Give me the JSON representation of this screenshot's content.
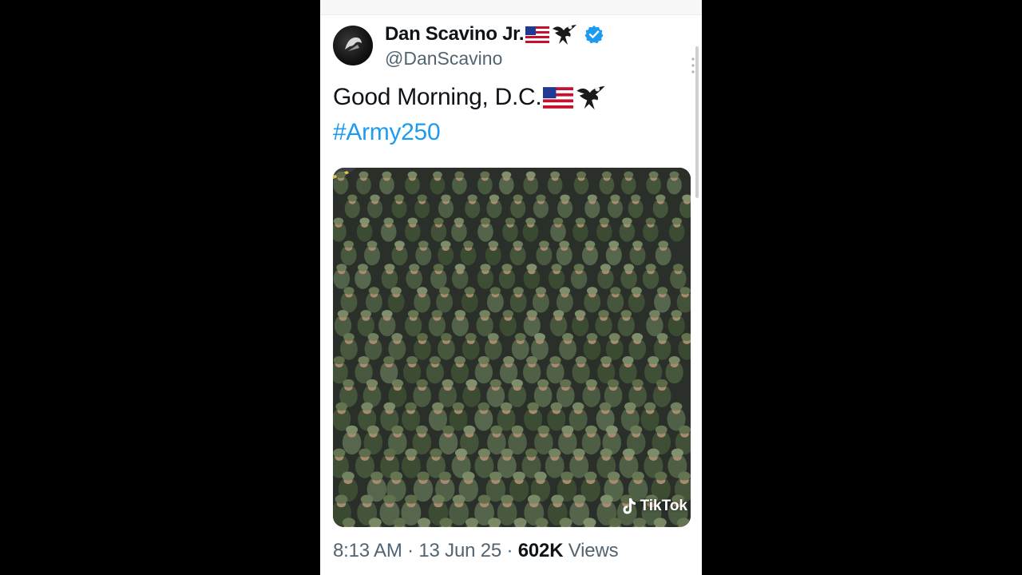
{
  "tweet": {
    "author": {
      "display_name": "Dan Scavino Jr.",
      "handle": "@DanScavino",
      "verified": true,
      "name_emojis": [
        "flag-usa-icon",
        "eagle-icon"
      ]
    },
    "text_line1": "Good Morning, D.C.",
    "text_emojis": [
      "flag-usa-icon",
      "eagle-icon"
    ],
    "hashtag": "#Army250",
    "media": {
      "description_icon": "photo",
      "watermark": "TikTok"
    },
    "meta": {
      "time": "8:13 AM",
      "separator": " · ",
      "date": "13 Jun 25",
      "views_count": "602K",
      "views_label": "Views"
    }
  },
  "colors": {
    "link": "#1d9bf0",
    "verified": "#1d9bf0",
    "text": "#0f1419",
    "secondary": "#536471",
    "background_outer": "#000000",
    "card_background": "#ffffff"
  }
}
